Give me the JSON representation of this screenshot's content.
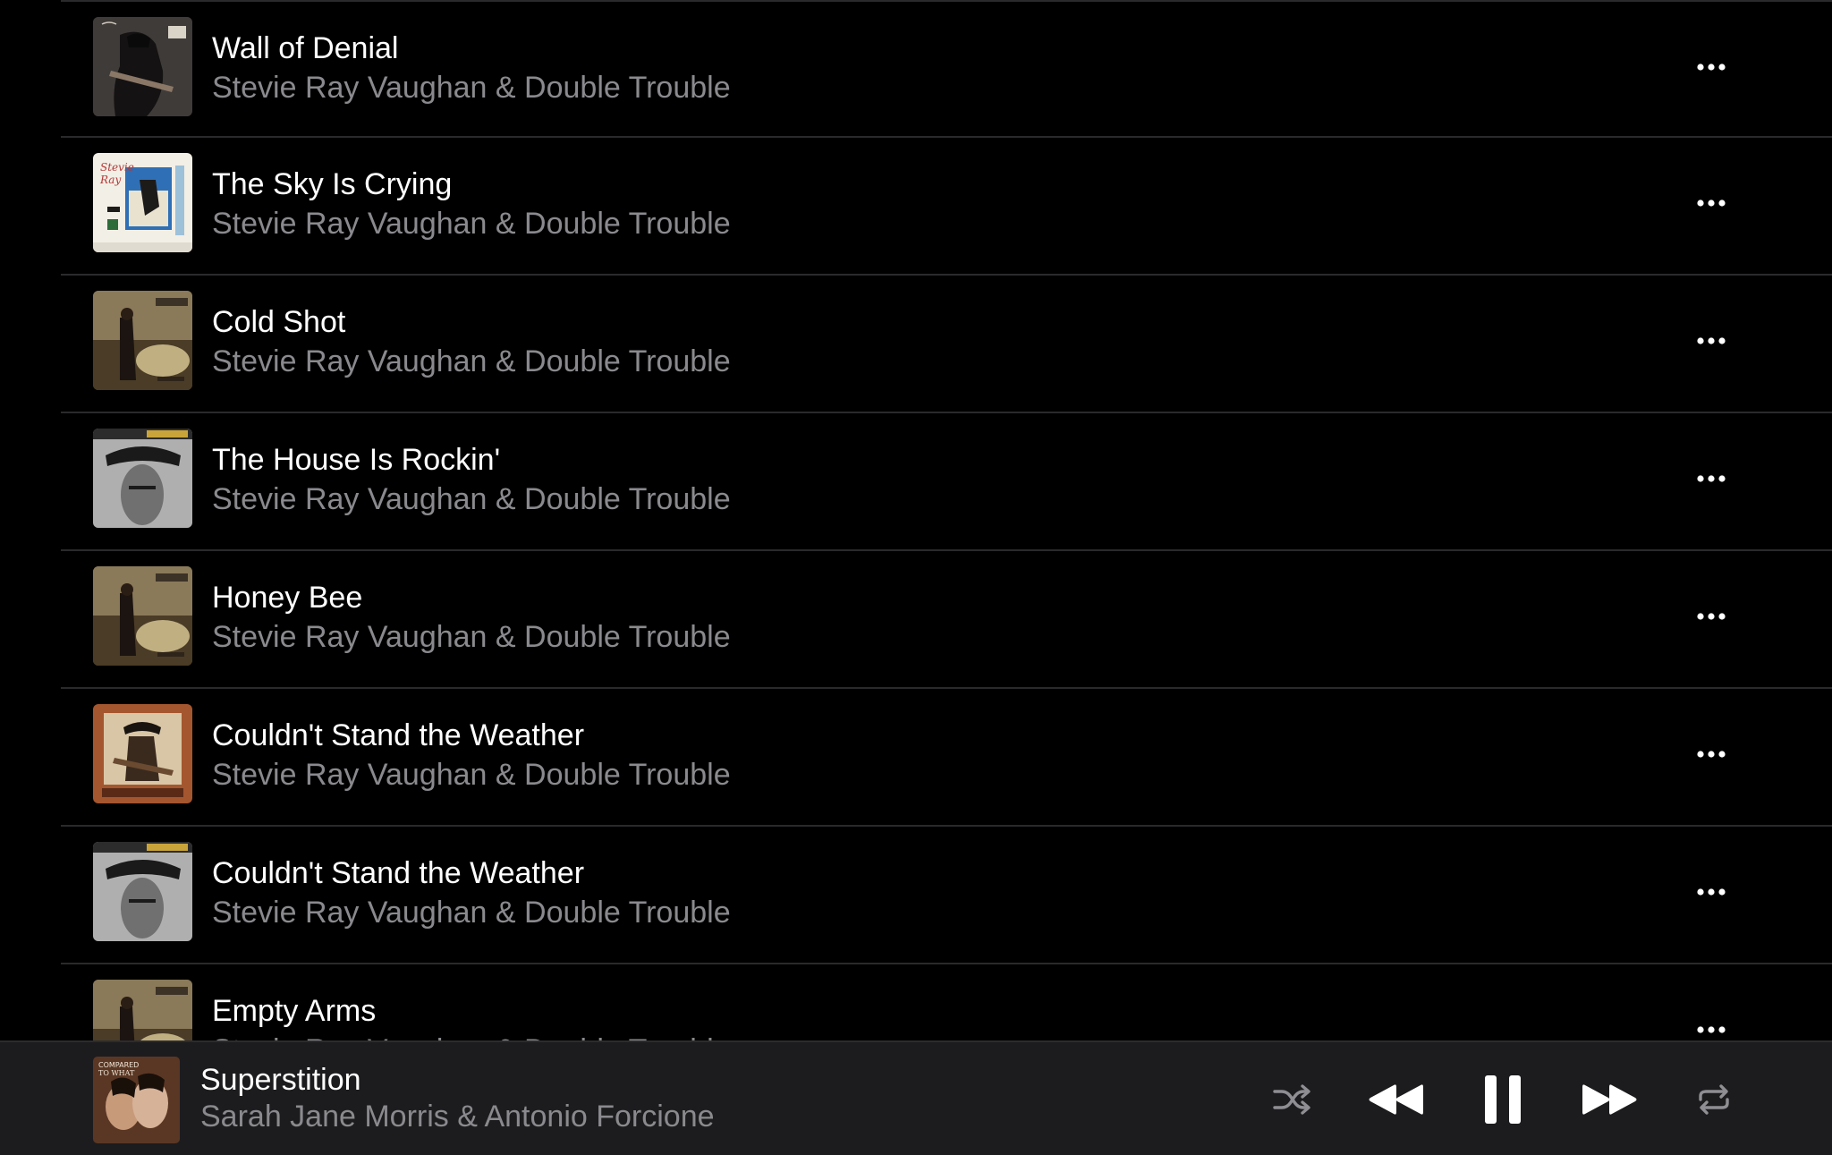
{
  "tracks": [
    {
      "title": "Wall of Denial",
      "artist": "Stevie Ray Vaughan & Double Trouble",
      "artwork": "in-step-cover"
    },
    {
      "title": "The Sky Is Crying",
      "artist": "Stevie Ray Vaughan & Double Trouble",
      "artwork": "sky-is-crying-cover"
    },
    {
      "title": "Cold Shot",
      "artist": "Stevie Ray Vaughan & Double Trouble",
      "artwork": "couldnt-stand-the-weather-cover"
    },
    {
      "title": "The House Is Rockin'",
      "artist": "Stevie Ray Vaughan & Double Trouble",
      "artwork": "essential-srv-cover"
    },
    {
      "title": "Honey Bee",
      "artist": "Stevie Ray Vaughan & Double Trouble",
      "artwork": "couldnt-stand-the-weather-cover"
    },
    {
      "title": "Couldn't Stand the Weather",
      "artist": "Stevie Ray Vaughan & Double Trouble",
      "artwork": "srv-portrait-cover"
    },
    {
      "title": "Couldn't Stand the Weather",
      "artist": "Stevie Ray Vaughan & Double Trouble",
      "artwork": "essential-srv-cover"
    },
    {
      "title": "Empty Arms",
      "artist": "Stevie Ray Vaughan & Double Trouble",
      "artwork": "couldnt-stand-the-weather-cover"
    }
  ],
  "now_playing": {
    "title": "Superstition",
    "artist": "Sarah Jane Morris & Antonio Forcione",
    "artwork": "compared-to-what-cover"
  },
  "icons": {
    "more": "ellipsis-icon",
    "shuffle": "shuffle-icon",
    "previous": "backward-icon",
    "pause": "pause-icon",
    "next": "forward-icon",
    "repeat": "repeat-icon"
  },
  "colors": {
    "background": "#000000",
    "primary_text": "#ffffff",
    "secondary_text": "#8a8a8e",
    "mini_player_bg": "#1c1c1e",
    "divider": "#2a2a2c"
  }
}
